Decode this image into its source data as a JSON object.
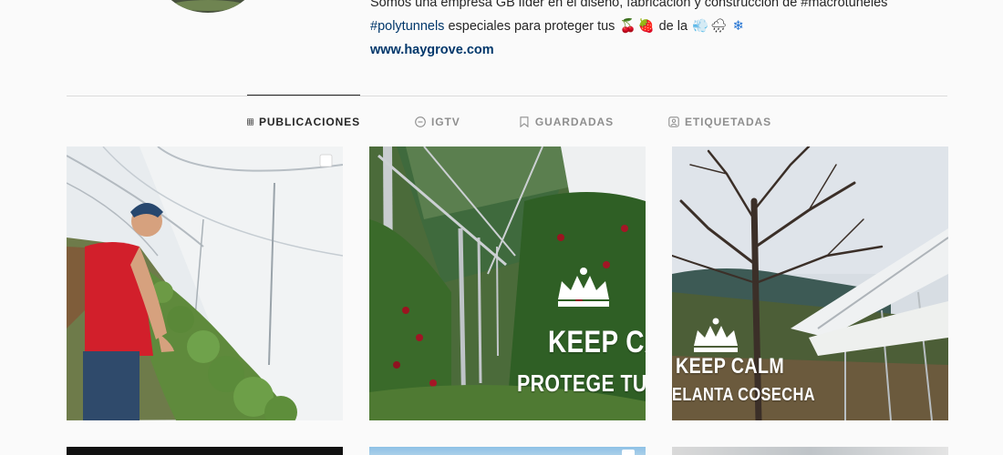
{
  "profile": {
    "bio_line1": "Somos una empresa GB líder en el diseño, fabricación y construcción de #macrotúneles",
    "bio_tag": "#polytunnels",
    "bio_line2_rest": " especiales para proteger tus ",
    "bio_line2_mid": " de la ",
    "emojis": [
      "🍒",
      "🍓",
      "💨",
      "🌧",
      "❄"
    ],
    "website": "www.haygrove.com"
  },
  "tabs": [
    {
      "label": "PUBLICACIONES",
      "icon": "grid-icon",
      "active": true
    },
    {
      "label": "IGTV",
      "icon": "igtv-icon",
      "active": false
    },
    {
      "label": "GUARDADAS",
      "icon": "bookmark-icon",
      "active": false
    },
    {
      "label": "ETIQUETADAS",
      "icon": "tag-person-icon",
      "active": false
    }
  ],
  "posts": [
    {
      "kind": "photo",
      "multi": true,
      "subject": "man in red shirt inspecting plants in a polytunnel"
    },
    {
      "kind": "graphic",
      "multi": false,
      "overlay": [
        "KEEP CAL",
        "PROTEGE TU CO"
      ]
    },
    {
      "kind": "graphic",
      "multi": false,
      "overlay": [
        "KEEP CALM",
        "ELANTA COSECHA"
      ]
    }
  ],
  "colors": {
    "page_bg": "#fafafa",
    "text": "#262626",
    "muted": "#8e8e8e",
    "link": "#00376b",
    "divider": "#dbdbdb"
  }
}
